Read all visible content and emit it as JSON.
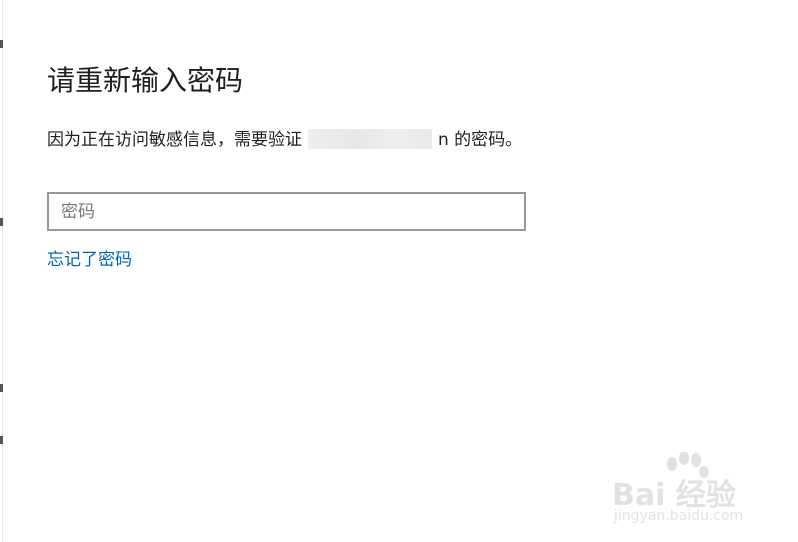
{
  "dialog": {
    "title": "请重新输入密码",
    "description_before": "因为正在访问敏感信息，需要验证",
    "description_after": "n 的密码。",
    "password": {
      "placeholder": "密码",
      "value": ""
    },
    "forgot_link": "忘记了密码"
  },
  "watermark": {
    "brand": "Bai 经验",
    "url": "jingyan.baidu.com"
  },
  "colors": {
    "link": "#0066b4",
    "input_border": "#999999",
    "text": "#1f1f1f"
  }
}
